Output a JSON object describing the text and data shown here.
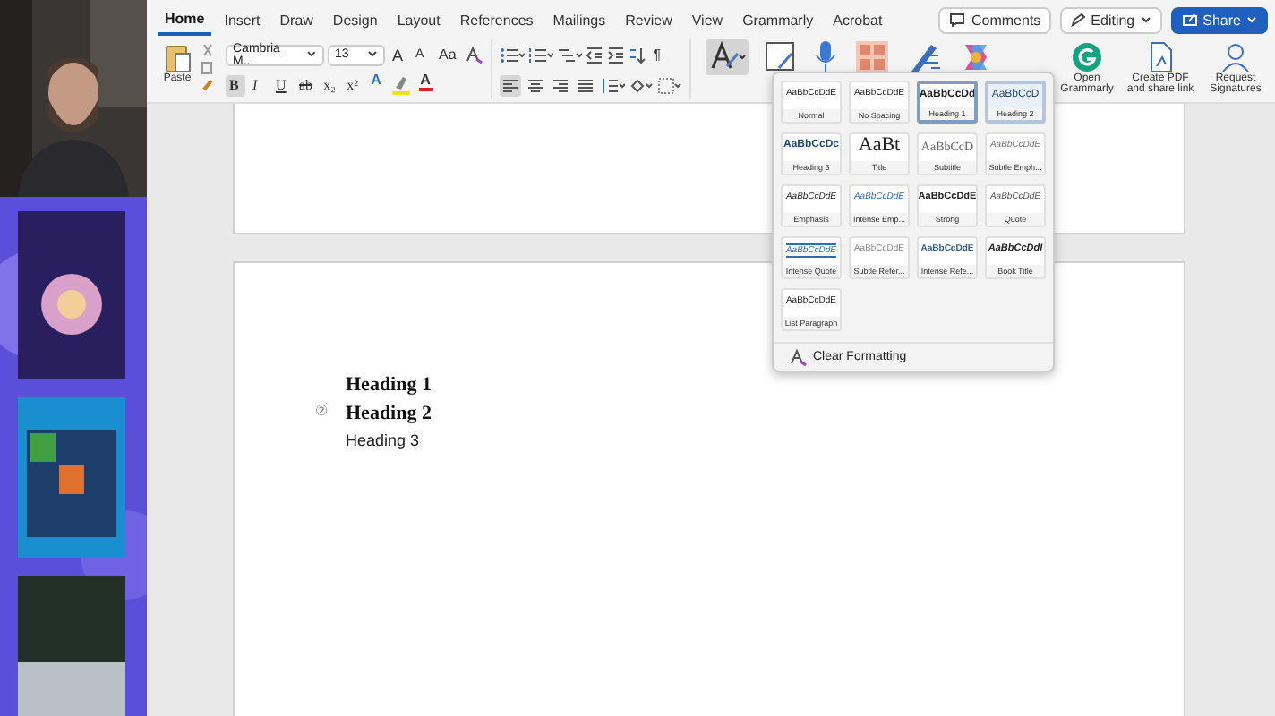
{
  "ribbon_tabs": [
    {
      "label": "Home",
      "selected": true
    },
    {
      "label": "Insert",
      "selected": false
    },
    {
      "label": "Draw",
      "selected": false
    },
    {
      "label": "Design",
      "selected": false
    },
    {
      "label": "Layout",
      "selected": false
    },
    {
      "label": "References",
      "selected": false
    },
    {
      "label": "Mailings",
      "selected": false
    },
    {
      "label": "Review",
      "selected": false
    },
    {
      "label": "View",
      "selected": false
    },
    {
      "label": "Grammarly",
      "selected": false
    },
    {
      "label": "Acrobat",
      "selected": false
    }
  ],
  "header_buttons": {
    "comments": "Comments",
    "editing": "Editing",
    "share": "Share"
  },
  "paste_label": "Paste",
  "font": {
    "name": "Cambria M...",
    "size": "13"
  },
  "font_buttons": [
    {
      "label": "A",
      "kind": "grow"
    },
    {
      "label": "A",
      "kind": "shrink"
    },
    {
      "label": "Aa",
      "kind": "case"
    }
  ],
  "format_buttons": [
    {
      "label": "B",
      "kind": "bold",
      "on": true
    },
    {
      "label": "I",
      "kind": "italic",
      "on": false
    },
    {
      "label": "U",
      "kind": "underline",
      "on": false
    },
    {
      "label": "ab",
      "kind": "strike",
      "on": false
    },
    {
      "label": "x₂",
      "kind": "sub",
      "on": false
    },
    {
      "label": "x²",
      "kind": "sup",
      "on": false
    }
  ],
  "color_buttons": [
    {
      "label": "A",
      "kind": "effects",
      "color": "#2b6fd6"
    },
    {
      "label": "A",
      "kind": "font-color",
      "color": "#e02020"
    }
  ],
  "paragraph_mark": "¶",
  "alignment": [
    {
      "kind": "left",
      "selected": true
    },
    {
      "kind": "center",
      "selected": false
    },
    {
      "kind": "right",
      "selected": false
    },
    {
      "kind": "justify",
      "selected": false
    }
  ],
  "side_buttons": [
    {
      "label": "Open Grammarly",
      "kind": "grammarly"
    },
    {
      "label": "Create PDF and share link",
      "kind": "pdf"
    },
    {
      "label": "Request Signatures",
      "kind": "signature"
    }
  ],
  "styles_gallery": {
    "items": [
      {
        "sample": "AaBbCcDdE",
        "name": "Normal",
        "kind": "normal",
        "selected": false,
        "hovered": false
      },
      {
        "sample": "AaBbCcDdE",
        "name": "No Spacing",
        "kind": "normal",
        "selected": false,
        "hovered": false
      },
      {
        "sample": "AaBbCcDd",
        "name": "Heading 1",
        "kind": "heading1",
        "selected": true,
        "hovered": false
      },
      {
        "sample": "AaBbCcD",
        "name": "Heading 2",
        "kind": "heading2",
        "selected": false,
        "hovered": true
      },
      {
        "sample": "AaBbCcDc",
        "name": "Heading 3",
        "kind": "heading3",
        "selected": false,
        "hovered": false
      },
      {
        "sample": "AaBt",
        "name": "Title",
        "kind": "title",
        "selected": false,
        "hovered": false
      },
      {
        "sample": "AaBbCcD",
        "name": "Subtitle",
        "kind": "subtitle",
        "selected": false,
        "hovered": false
      },
      {
        "sample": "AaBbCcDdE",
        "name": "Subtle Emph...",
        "kind": "subtle",
        "selected": false,
        "hovered": false
      },
      {
        "sample": "AaBbCcDdE",
        "name": "Emphasis",
        "kind": "emphasis",
        "selected": false,
        "hovered": false
      },
      {
        "sample": "AaBbCcDdE",
        "name": "Intense Emp...",
        "kind": "intense",
        "selected": false,
        "hovered": false
      },
      {
        "sample": "AaBbCcDdE",
        "name": "Strong",
        "kind": "strong",
        "selected": false,
        "hovered": false
      },
      {
        "sample": "AaBbCcDdE",
        "name": "Quote",
        "kind": "quote",
        "selected": false,
        "hovered": false
      },
      {
        "sample": "AaBbCcDdE",
        "name": "Intense Quote",
        "kind": "intense-quote",
        "selected": false,
        "hovered": false
      },
      {
        "sample": "AaBbCcDdE",
        "name": "Subtle Refer...",
        "kind": "subtle-ref",
        "selected": false,
        "hovered": false
      },
      {
        "sample": "AaBbCcDdE",
        "name": "Intense Refe...",
        "kind": "intense-ref",
        "selected": false,
        "hovered": false
      },
      {
        "sample": "AaBbCcDdI",
        "name": "Book Title",
        "kind": "book-title",
        "selected": false,
        "hovered": false
      },
      {
        "sample": "AaBbCcDdE",
        "name": "List Paragraph",
        "kind": "normal",
        "selected": false,
        "hovered": false
      }
    ],
    "clear_formatting": "Clear Formatting"
  },
  "document": {
    "marker": "②",
    "paragraphs": [
      {
        "text": "Heading 1",
        "kind": "heading1"
      },
      {
        "text": "Heading 2",
        "kind": "heading2"
      },
      {
        "text": "Heading 3",
        "kind": "heading3"
      }
    ]
  }
}
